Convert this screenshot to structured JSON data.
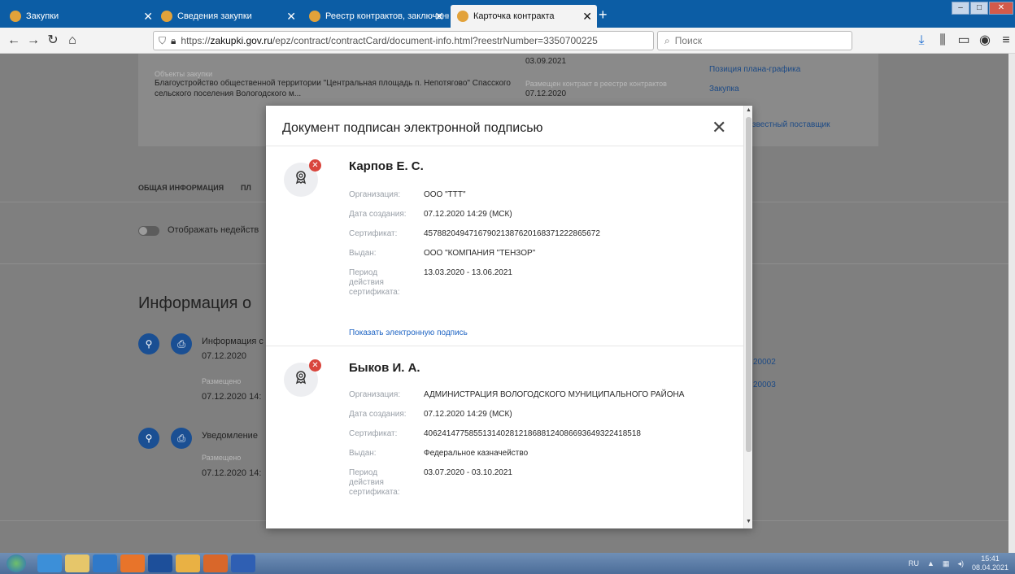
{
  "tabs": [
    {
      "label": "Закупки"
    },
    {
      "label": "Сведения закупки"
    },
    {
      "label": "Реестр контрактов, заключенн"
    },
    {
      "label": "Карточка контракта"
    }
  ],
  "url": {
    "host": "zakupki.gov.ru",
    "rest": "/epz/contract/contractCard/document-info.html?reestrNumber=3350700225",
    "prefix": "https://"
  },
  "search": {
    "placeholder": "Поиск"
  },
  "background": {
    "objects_label": "Объекты закупки",
    "objects_text": "Благоустройство общественной территории \"Центральная площадь п. Непотягово\" Спасского сельского поселения Вологодского м...",
    "date_top": "03.09.2021",
    "placed_label": "Размещен контракт в реестре контрактов",
    "placed_date": "07.12.2020",
    "link_plan": "Позиция плана-графика",
    "link_purchase": "Закупка",
    "link_supplier": "звестный поставщик",
    "tab_general": "ОБЩАЯ ИНФОРМАЦИЯ",
    "tab_next": "ПЛ",
    "toggle_label": "Отображать недейств",
    "section_title": "Информация о",
    "doc1_title": "Информация с",
    "doc1_date": "07.12.2020",
    "doc1_placed_label": "Размещено",
    "doc1_placed": "07.12.2020 14:",
    "doc1_num1": "20002",
    "doc1_num2": "20003",
    "doc2_title": "Уведомление",
    "doc2_placed_label": "Размещено",
    "doc2_placed": "07.12.2020 14:"
  },
  "modal": {
    "title": "Документ подписан электронной подписью",
    "show_signature": "Показать электронную подпись",
    "signers": [
      {
        "name": "Карпов Е. С.",
        "rows": [
          {
            "k": "Организация:",
            "v": "ООО \"ТТТ\""
          },
          {
            "k": "Дата создания:",
            "v": "07.12.2020 14:29 (МСК)"
          },
          {
            "k": "Сертификат:",
            "v": "457882049471679021387620168371222865672"
          },
          {
            "k": "Выдан:",
            "v": "ООО \"КОМПАНИЯ \"ТЕНЗОР\""
          },
          {
            "k": "Период действия сертификата:",
            "v": "13.03.2020 - 13.06.2021"
          }
        ]
      },
      {
        "name": "Быков И. А.",
        "rows": [
          {
            "k": "Организация:",
            "v": "АДМИНИСТРАЦИЯ ВОЛОГОДСКОГО МУНИЦИПАЛЬНОГО РАЙОНА"
          },
          {
            "k": "Дата создания:",
            "v": "07.12.2020 14:29 (МСК)"
          },
          {
            "k": "Сертификат:",
            "v": "406241477585513140281218688124086693649322418518"
          },
          {
            "k": "Выдан:",
            "v": "Федеральное казначейство"
          },
          {
            "k": "Период действия сертификата:",
            "v": "03.07.2020 - 03.10.2021"
          }
        ]
      }
    ]
  },
  "tray": {
    "lang": "RU",
    "time": "15:41",
    "date": "08.04.2021"
  },
  "colors": {
    "tabstrip": "#0c5da5",
    "overlay": "#7f7f7f",
    "link": "#1d63c3",
    "error": "#d9453d",
    "round_btn": "#1a4f93"
  }
}
